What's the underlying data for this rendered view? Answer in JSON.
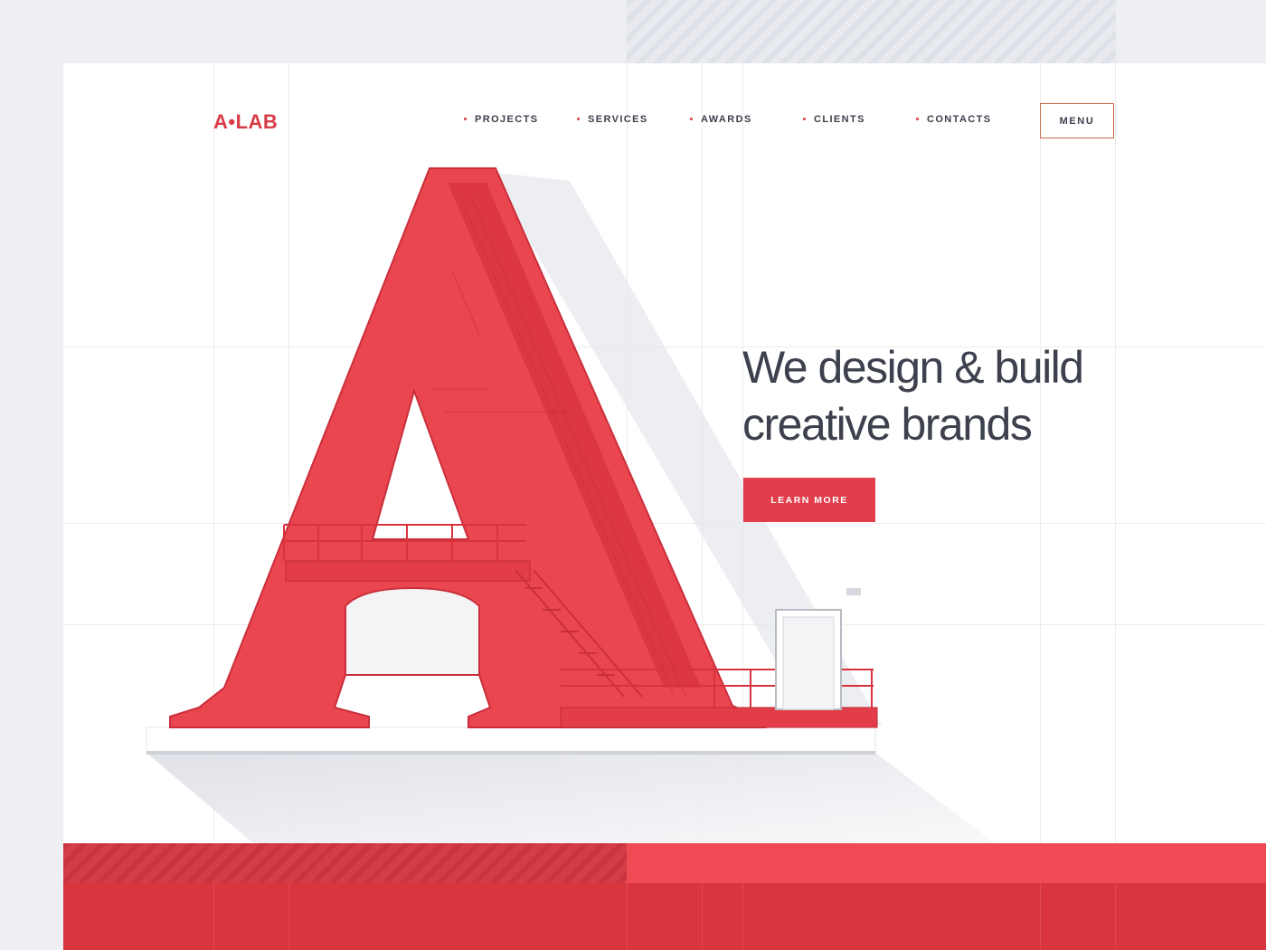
{
  "brand": {
    "logo": "A•LAB",
    "accent_color": "#d83a46",
    "text_color": "#3d404d"
  },
  "nav": {
    "items": [
      {
        "label": "PROJECTS"
      },
      {
        "label": "SERVICES"
      },
      {
        "label": "AWARDS"
      },
      {
        "label": "CLIENTS"
      },
      {
        "label": "CONTACTS"
      }
    ],
    "menu_label": "MENU"
  },
  "hero": {
    "title_line1": "We design & build",
    "title_line2": "creative brands",
    "cta_label": "LEARN MORE"
  },
  "illustration": {
    "subject": "giant red letter A building with stairs, railings and a door"
  }
}
